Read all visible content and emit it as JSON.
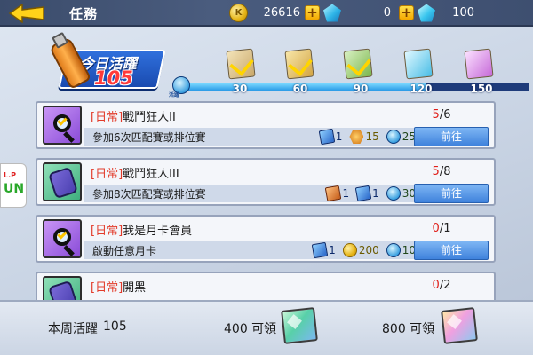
{
  "header": {
    "title": "任務",
    "coins": "26616",
    "gems": "0",
    "tickets": "100"
  },
  "activity": {
    "label": "今日活躍",
    "value": "105",
    "progress_icon_label": "活躍",
    "milestones": [
      "30",
      "60",
      "90",
      "120",
      "150"
    ],
    "progress_fraction": 0.7
  },
  "tasks": [
    {
      "tag": "[日常]",
      "name": "戰鬥狂人II",
      "description": "參加6次匹配賽或排位賽",
      "progress_current": "5",
      "progress_total": "/6",
      "button": "前往",
      "rewards": [
        "1",
        "15",
        "25"
      ]
    },
    {
      "tag": "[日常]",
      "name": "戰鬥狂人III",
      "description": "參加8次匹配賽或排位賽",
      "progress_current": "5",
      "progress_total": "/8",
      "button": "前往",
      "rewards": [
        "1",
        "1",
        "30"
      ]
    },
    {
      "tag": "[日常]",
      "name": "我是月卡會員",
      "description": "啟動任意月卡",
      "progress_current": "0",
      "progress_total": "/1",
      "button": "前往",
      "rewards": [
        "1",
        "200",
        "10"
      ]
    },
    {
      "tag": "[日常]",
      "name": "開黑",
      "progress_current": "0",
      "progress_total": "/2"
    }
  ],
  "side": {
    "logo_top": "L.P",
    "logo_bottom": "UN"
  },
  "footer": {
    "weekly_label": "本周活躍",
    "weekly_value": "105",
    "reward1_label": "400 可領",
    "reward2_label": "800 可領"
  },
  "colors": {
    "accent_blue": "#3f82dc",
    "progress_red": "#e0201a",
    "tag_red": "#e23b2a",
    "coin_gold": "#e6b416"
  }
}
